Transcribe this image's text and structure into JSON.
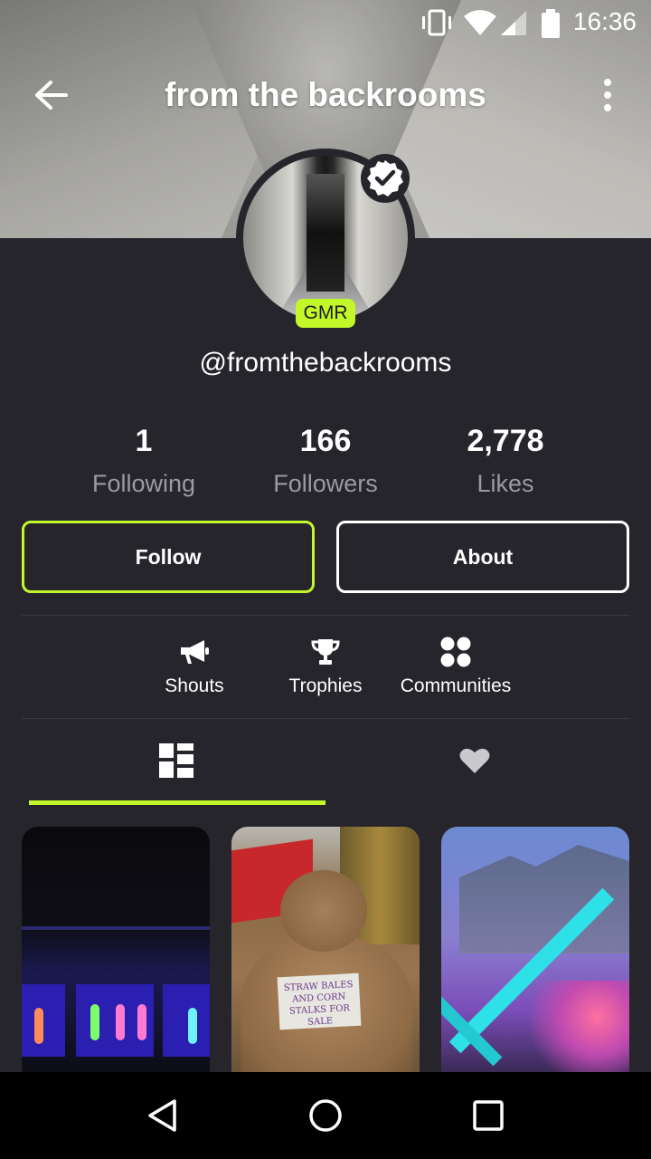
{
  "status_bar": {
    "time": "16:36",
    "icons": [
      "vibrate-icon",
      "wifi-icon",
      "signal-icon",
      "battery-icon"
    ]
  },
  "header": {
    "title": "from the backrooms",
    "back_icon": "arrow-left-icon",
    "menu_icon": "more-vertical-icon"
  },
  "profile": {
    "username": "@fromthebackrooms",
    "badge": "GMR",
    "verified": true,
    "badge_color": "#c2f82a"
  },
  "stats": [
    {
      "value": "1",
      "label": "Following"
    },
    {
      "value": "166",
      "label": "Followers"
    },
    {
      "value": "2,778",
      "label": "Likes"
    }
  ],
  "actions": {
    "follow_label": "Follow",
    "about_label": "About"
  },
  "shortcuts": [
    {
      "label": "Shouts",
      "icon": "megaphone-icon"
    },
    {
      "label": "Trophies",
      "icon": "trophy-icon"
    },
    {
      "label": "Communities",
      "icon": "communities-icon"
    }
  ],
  "tabs": [
    {
      "icon": "grid-icon",
      "active": true
    },
    {
      "icon": "heart-icon",
      "active": false
    }
  ],
  "posts": [
    {
      "thumbnail": "neon-skeletons-window"
    },
    {
      "thumbnail": "teddy-bear-sign",
      "sign_text": "STRAW BALES AND CORN STALKS FOR SALE"
    },
    {
      "thumbnail": "neon-building"
    }
  ],
  "nav": {
    "back_icon": "nav-back-icon",
    "home_icon": "nav-home-icon",
    "recents_icon": "nav-recents-icon"
  },
  "colors": {
    "background": "#26252c",
    "accent": "#c2f82a",
    "muted_text": "#9b9aa0"
  }
}
